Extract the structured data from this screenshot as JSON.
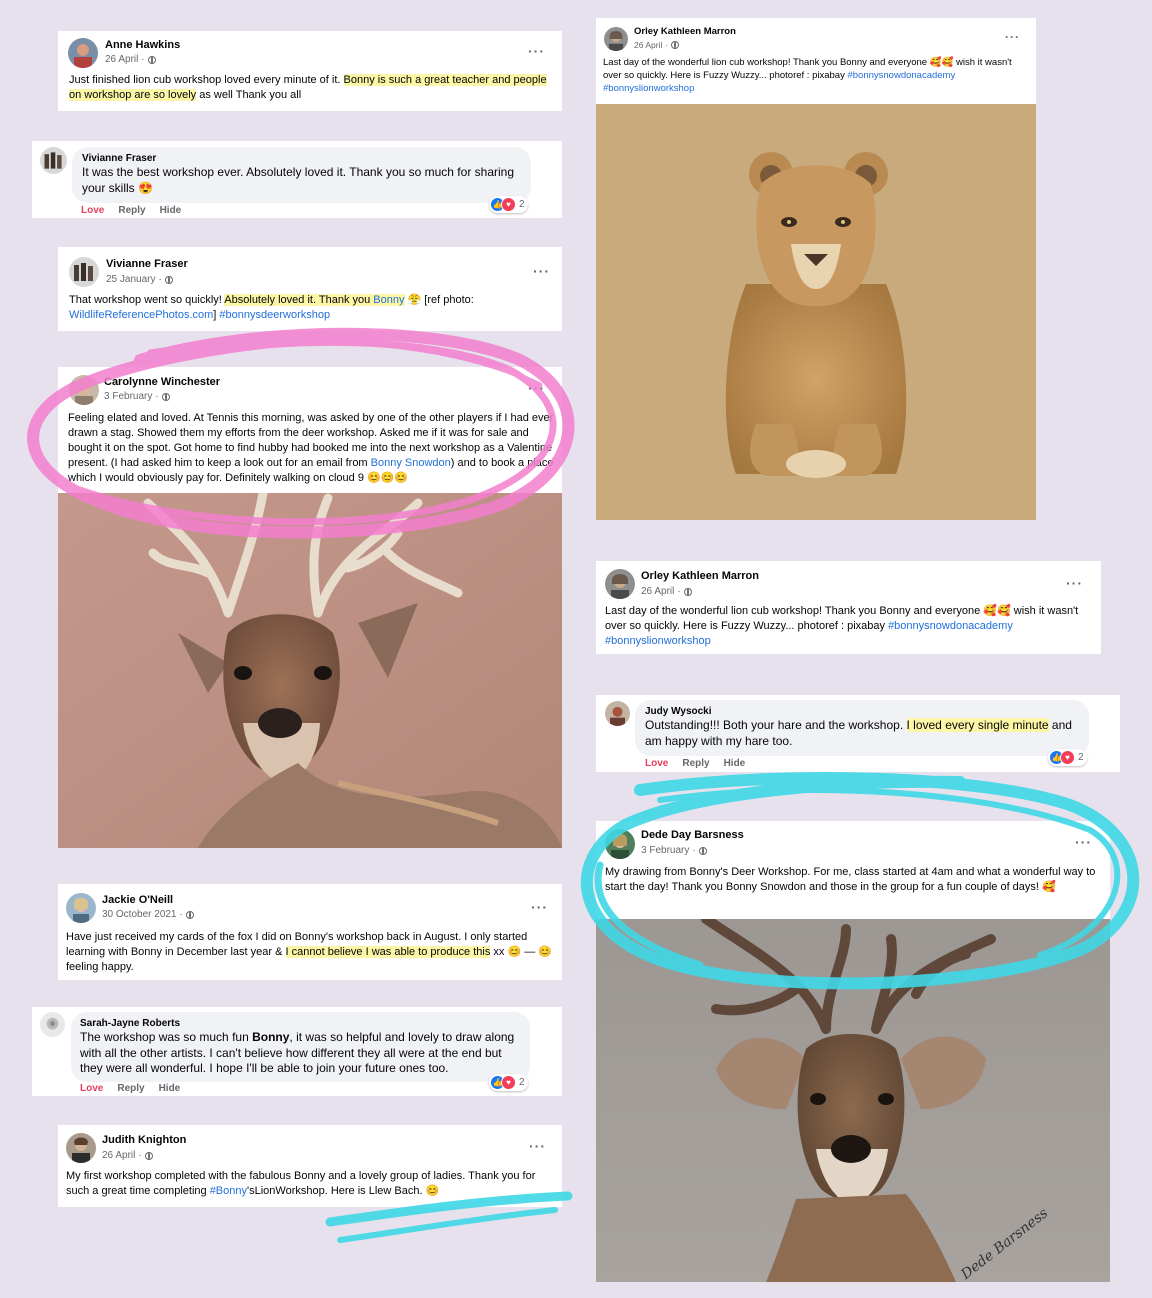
{
  "posts": [
    {
      "name": "Anne Hawkins",
      "date": "26 April",
      "text": [
        {
          "t": "Just finished lion cub workshop loved every minute of it. "
        },
        {
          "t": "Bonny is such a great teacher and people on workshop are so lovely",
          "hl": true
        },
        {
          "t": " as well Thank you all"
        }
      ]
    },
    {
      "name": "Vivianne Fraser",
      "date": "25 January",
      "text": [
        {
          "t": "That workshop went so quickly! "
        },
        {
          "t": "Absolutely loved it. Thank you ",
          "hl": true
        },
        {
          "t": "Bonny",
          "hl": true,
          "link": true
        },
        {
          "t": " 😤 [ref photo: "
        },
        {
          "t": "WildlifeReferencePhotos.com",
          "link": true
        },
        {
          "t": "] "
        },
        {
          "t": "#bonnysdeerworkshop",
          "tag": true
        }
      ]
    },
    {
      "name": "Carolynne Winchester",
      "date": "3 February",
      "text": [
        {
          "t": "Feeling elated and loved. At Tennis this morning, was asked by one of the other players if I had ever drawn a stag. Showed them my efforts from the deer workshop. Asked me if it was for sale and bought it on the spot. Got home to find hubby had booked me into the next workshop as a Valentine present. (I had asked him to keep a look out for an email from "
        },
        {
          "t": "Bonny Snowdon",
          "link": true
        },
        {
          "t": ") and to book a place which I would obviously pay for.   Definitely walking on cloud 9 😊😊😊"
        }
      ]
    },
    {
      "name": "Jackie O'Neill",
      "date": "30 October 2021",
      "text": [
        {
          "t": "Have just received my cards of the fox I did on Bonny's workshop back in August. I only started learning with Bonny in December last year & "
        },
        {
          "t": "I cannot believe I was able to produce this",
          "hl": true
        },
        {
          "t": " xx 😊 — 😊 feeling happy."
        }
      ]
    },
    {
      "name": "Judith Knighton",
      "date": "26 April",
      "text": [
        {
          "t": "My first workshop completed with the fabulous Bonny and a lovely group of ladies.  Thank you for such a great time completing "
        },
        {
          "t": "#Bonny",
          "tag": true
        },
        {
          "t": "'sLionWorkshop.  Here is Llew Bach. 😊"
        }
      ]
    },
    {
      "name": "Orley Kathleen Marron",
      "date": "26 April",
      "text": [
        {
          "t": "Last day of the wonderful lion cub workshop! Thank you Bonny and everyone 🥰🥰 wish it wasn't over so quickly. Here is Fuzzy Wuzzy... photoref : pixabay "
        },
        {
          "t": "#bonnysnowdonacademy #bonnyslionworkshop",
          "tag": true
        }
      ]
    },
    {
      "name": "Orley Kathleen Marron",
      "date": "26 April",
      "text": [
        {
          "t": "Last day of the wonderful lion cub workshop! Thank you Bonny and everyone 🥰🥰 wish it wasn't over so quickly. Here is Fuzzy Wuzzy... photoref : pixabay "
        },
        {
          "t": "#bonnysnowdonacademy #bonnyslionworkshop",
          "tag": true
        }
      ]
    },
    {
      "name": "Dede Day Barsness",
      "date": "3 February",
      "text": [
        {
          "t": "My drawing from Bonny's Deer Workshop.  For me, class started at 4am and what a wonderful way to start the day!  Thank you Bonny Snowdon and those in the group for a fun couple of days! 🥰"
        }
      ]
    }
  ],
  "comments": [
    {
      "name": "Vivianne Fraser",
      "text": [
        {
          "t": "It was the best workshop ever. Absolutely loved it. Thank you so much for sharing your skills 😍"
        }
      ],
      "reactions": "2"
    },
    {
      "name": "Sarah-Jayne Roberts",
      "text": [
        {
          "t": "The workshop was so much fun "
        },
        {
          "t": "Bonny",
          "bold": true
        },
        {
          "t": ", it was so helpful and lovely to draw along with all the other artists. I can't believe how different they all were at the end but they were all wonderful. I hope I'll be able to join your future ones too."
        }
      ],
      "reactions": "2"
    },
    {
      "name": "Judy Wysocki",
      "text": [
        {
          "t": "Outstanding!!! Both your hare and the workshop. "
        },
        {
          "t": "I loved every single minute",
          "hl": true
        },
        {
          "t": " and am happy with my hare too."
        }
      ],
      "reactions": "2"
    }
  ],
  "actions": {
    "love": "Love",
    "reply": "Reply",
    "hide": "Hide"
  },
  "icons": {
    "more": "more-options-icon",
    "privacy": "globe-icon",
    "like": "like-reaction-icon",
    "love": "love-reaction-icon"
  },
  "colors": {
    "highlight": "#fbf7a6",
    "link": "#216fdb",
    "pink_scribble": "#f47fcf",
    "cyan_scribble": "#3fd8e6",
    "love_action": "#e4405f"
  }
}
